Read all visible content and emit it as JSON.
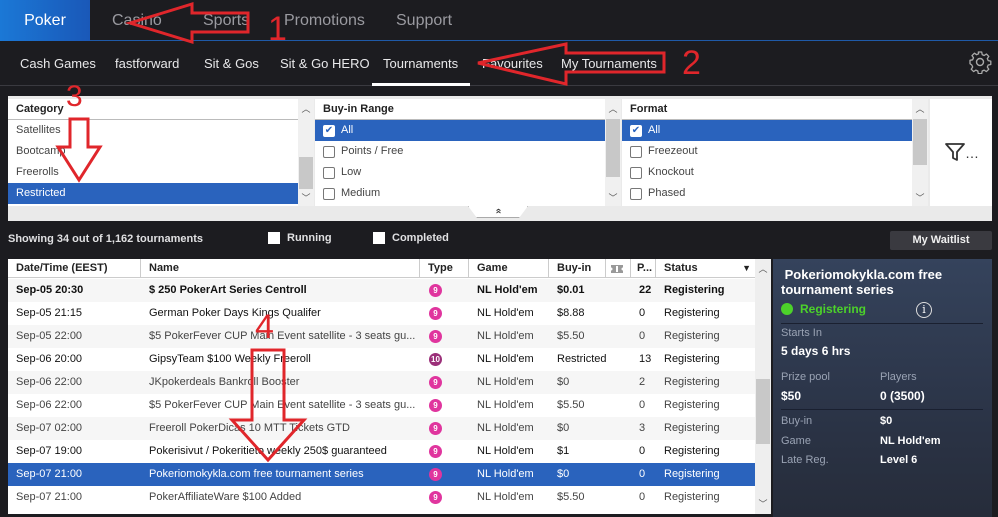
{
  "top_nav": {
    "tabs": [
      {
        "label": "Poker",
        "active": true
      },
      {
        "label": "Casino",
        "active": false
      },
      {
        "label": "Sports",
        "active": false
      },
      {
        "label": "Promotions",
        "active": false
      },
      {
        "label": "Support",
        "active": false
      }
    ]
  },
  "sub_nav": {
    "tabs": [
      {
        "label": "Cash Games"
      },
      {
        "label": "fastforward"
      },
      {
        "label": "Sit & Gos"
      },
      {
        "label": "Sit & Go HERO"
      },
      {
        "label": "Tournaments",
        "active": true
      },
      {
        "label": "Favourites"
      },
      {
        "label": "My Tournaments"
      }
    ],
    "settings_icon": "gear-icon"
  },
  "filters": {
    "category": {
      "header": "Category",
      "items": [
        {
          "label": "Satellites",
          "selected": false
        },
        {
          "label": "Bootcamp",
          "selected": false
        },
        {
          "label": "Freerolls",
          "selected": false
        },
        {
          "label": "Restricted",
          "selected": true
        }
      ]
    },
    "buyin_range": {
      "header": "Buy-in Range",
      "items": [
        {
          "label": "All",
          "checked": true
        },
        {
          "label": "Points / Free",
          "checked": false
        },
        {
          "label": "Low",
          "checked": false
        },
        {
          "label": "Medium",
          "checked": false
        }
      ]
    },
    "format": {
      "header": "Format",
      "items": [
        {
          "label": "All",
          "checked": true
        },
        {
          "label": "Freezeout",
          "checked": false
        },
        {
          "label": "Knockout",
          "checked": false
        },
        {
          "label": "Phased",
          "checked": false
        }
      ]
    },
    "more_filters_label": "…",
    "collapse_glyph": "«"
  },
  "status_bar": {
    "showing_text": "Showing 34 out of 1,162 tournaments",
    "running_label": "Running",
    "running_checked": false,
    "completed_label": "Completed",
    "completed_checked": false,
    "waitlist_button": "My Waitlist"
  },
  "table": {
    "columns": [
      "Date/Time (EEST)",
      "Name",
      "Type",
      "Game",
      "Buy-in",
      "",
      "P...",
      "Status"
    ],
    "rows": [
      {
        "date": "Sep-05 20:30",
        "name": "$ 250 PokerArt Series Centroll",
        "type": "9",
        "game": "NL Hold'em",
        "buyin": "$0.01",
        "players": "22",
        "status": "Registering",
        "style": "bold"
      },
      {
        "date": "Sep-05 21:15",
        "name": "German Poker Days Kings Qualifer",
        "type": "9",
        "game": "NL Hold'em",
        "buyin": "$8.88",
        "players": "0",
        "status": "Registering",
        "style": "dark"
      },
      {
        "date": "Sep-05 22:00",
        "name": "$5 PokerFever CUP Main Event satellite - 3 seats  gu...",
        "type": "9",
        "game": "NL Hold'em",
        "buyin": "$5.50",
        "players": "0",
        "status": "Registering",
        "style": "normal"
      },
      {
        "date": "Sep-06 20:00",
        "name": "GipsyTeam $100 Weekly Freeroll",
        "type": "10",
        "game": "NL Hold'em",
        "buyin": "Restricted",
        "players": "13",
        "status": "Registering",
        "style": "dark"
      },
      {
        "date": "Sep-06 22:00",
        "name": "JKpokerdeals Bankroll Booster",
        "type": "9",
        "game": "NL Hold'em",
        "buyin": "$0",
        "players": "2",
        "status": "Registering",
        "style": "normal"
      },
      {
        "date": "Sep-06 22:00",
        "name": "$5 PokerFever CUP Main Event satellite - 3 seats  gu...",
        "type": "9",
        "game": "NL Hold'em",
        "buyin": "$5.50",
        "players": "0",
        "status": "Registering",
        "style": "normal"
      },
      {
        "date": "Sep-07 02:00",
        "name": "Freeroll PokerDicas 10 MTT Tickets GTD",
        "type": "9",
        "game": "NL Hold'em",
        "buyin": "$0",
        "players": "3",
        "status": "Registering",
        "style": "normal"
      },
      {
        "date": "Sep-07 19:00",
        "name": "Pokerisivut / Pokeritieto weekly 250$ guaranteed",
        "type": "9",
        "game": "NL Hold'em",
        "buyin": "$1",
        "players": "0",
        "status": "Registering",
        "style": "dark"
      },
      {
        "date": "Sep-07 21:00",
        "name": " Pokeriomokykla.com free tournament series",
        "type": "9",
        "game": "NL Hold'em",
        "buyin": "$0",
        "players": "0",
        "status": "Registering",
        "style": "selected"
      },
      {
        "date": "Sep-07 21:00",
        "name": "PokerAffiliateWare $100 Added",
        "type": "9",
        "game": "NL Hold'em",
        "buyin": "$5.50",
        "players": "0",
        "status": "Registering",
        "style": "normal"
      }
    ]
  },
  "details": {
    "title": " Pokeriomokykla.com free\ntournament series",
    "status": "Registering",
    "status_color": "#4cd22a",
    "starts_in_label": "Starts In",
    "starts_in_value": "5 days 6 hrs",
    "prize_pool_label": "Prize pool",
    "prize_pool_value": "$50",
    "players_label": "Players",
    "players_value": "0 (3500)",
    "buyin_label": "Buy-in",
    "buyin_value": "$0",
    "game_label": "Game",
    "game_value": "NL Hold'em",
    "late_reg_label": "Late Reg.",
    "late_reg_value": "Level 6"
  },
  "annotations": {
    "n1": "1",
    "n2": "2",
    "n3": "3",
    "n4": "4",
    "color": "#e0262b"
  },
  "colors": {
    "accent_blue": "#2a63bd",
    "type_badge": "#e0359e",
    "type_badge_10": "#9b2f79"
  }
}
